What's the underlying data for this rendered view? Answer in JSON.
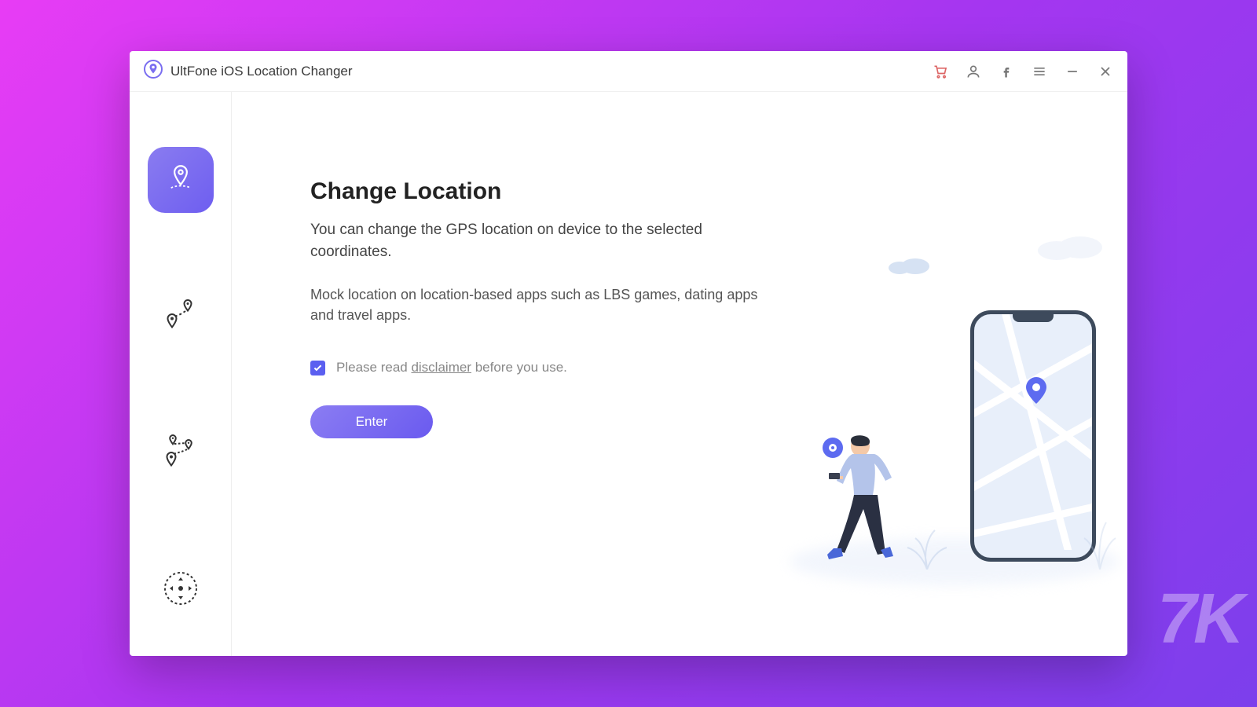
{
  "app": {
    "title": "UltFone iOS Location Changer"
  },
  "titlebar_icons": {
    "cart": "cart-icon",
    "user": "user-icon",
    "facebook": "facebook-icon",
    "menu": "menu-icon",
    "minimize": "minimize-icon",
    "close": "close-icon"
  },
  "sidebar": {
    "items": [
      {
        "id": "change-location",
        "active": true
      },
      {
        "id": "single-spot",
        "active": false
      },
      {
        "id": "multi-spot",
        "active": false
      },
      {
        "id": "joystick",
        "active": false
      }
    ]
  },
  "main": {
    "heading": "Change Location",
    "desc1": "You can change the GPS location on device to the selected coordinates.",
    "desc2": "Mock location on location-based apps such as LBS games, dating apps and travel apps.",
    "disclaimer_prefix": "Please read ",
    "disclaimer_link": "disclaimer",
    "disclaimer_suffix": " before you use.",
    "enter_label": "Enter"
  },
  "watermark": "7K"
}
